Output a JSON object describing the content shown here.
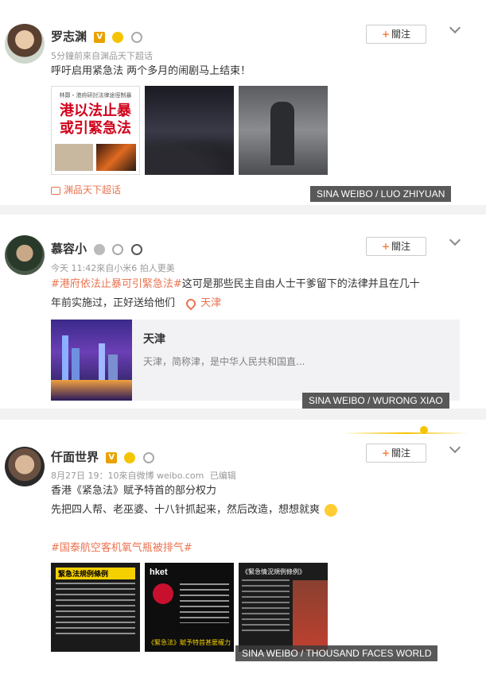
{
  "posts": [
    {
      "username": "罗志渊",
      "meta": "5分鐘前來自渊品天下超话",
      "text": "呼吁启用紧急法 两个多月的闹剧马上结束！",
      "follow_label": "關注",
      "thumb1_headline_top": "林鄭・港府研討法律途徑制暴",
      "thumb1_headline_line1": "港以法止暴",
      "thumb1_headline_line2": "或引緊急法",
      "supertopic": "渊品天下超话",
      "watermark": "SINA WEIBO / LUO ZHIYUAN"
    },
    {
      "username": "慕容小",
      "meta": "今天 11:42來自小米6 拍人更美",
      "hashtag": "#港府依法止暴可引緊急法#",
      "text_line1_rest": "这可是那些民主自由人士干爹留下的法律并且在几十",
      "text_line2": "年前实施过，正好送给他们",
      "location": "天津",
      "follow_label": "關注",
      "card_title": "天津",
      "card_desc": "天津，简称津，是中华人民共和国直...",
      "watermark": "SINA WEIBO / WURONG XIAO"
    },
    {
      "username": "仟面世界",
      "meta_date": "8月27日 19：10來自微博 weibo.com",
      "meta_edited": "已编辑",
      "text_line1": "香港《紧急法》赋予特首的部分权力",
      "text_line2": "先把四人帮、老巫婆、十八针抓起来，然后改造，想想就爽",
      "hashtag": "#国泰航空客机氧气瓶被排气#",
      "follow_label": "關注",
      "thumb1_title": "緊急法規例條例",
      "thumb2_brand": "hket",
      "thumb2_caption": "《緊急法》賦予特首甚麼權力？",
      "thumb3_title": "《緊急情況規例條例》",
      "watermark": "SINA WEIBO / THOUSAND FACES WORLD"
    }
  ],
  "icons": {
    "vip": "v-badge-icon",
    "crown": "crown-icon",
    "ring": "ring-icon",
    "panda": "panda-icon",
    "location": "location-pin-icon",
    "chevron": "chevron-down-icon"
  },
  "colors": {
    "accent": "#eb7350",
    "follow_plus": "#fa7d3c",
    "meta": "#999999"
  }
}
